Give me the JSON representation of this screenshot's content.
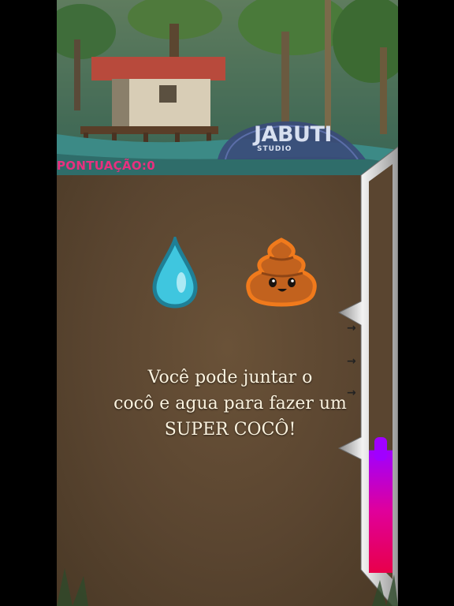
{
  "hud": {
    "score_label": "PONTUAÇÃO:0"
  },
  "logo": {
    "name": "JABUTI",
    "sub": "STUDIO"
  },
  "tip": {
    "lines": [
      "Você pode juntar o",
      "cocô e agua para fazer um",
      "SUPER COCÔ!"
    ]
  },
  "icons": {
    "water": "water-drop-icon",
    "poop": "poop-icon",
    "arrow": "arrow-right-icon"
  },
  "meter": {
    "level": 0.3,
    "colors": [
      "#a000ff",
      "#e0009a",
      "#e8004a"
    ]
  },
  "colors": {
    "score": "#e8307f",
    "text": "#fbf3df",
    "dirt": "#5a4530",
    "water": "#35c3de",
    "poop": "#c2621e"
  }
}
